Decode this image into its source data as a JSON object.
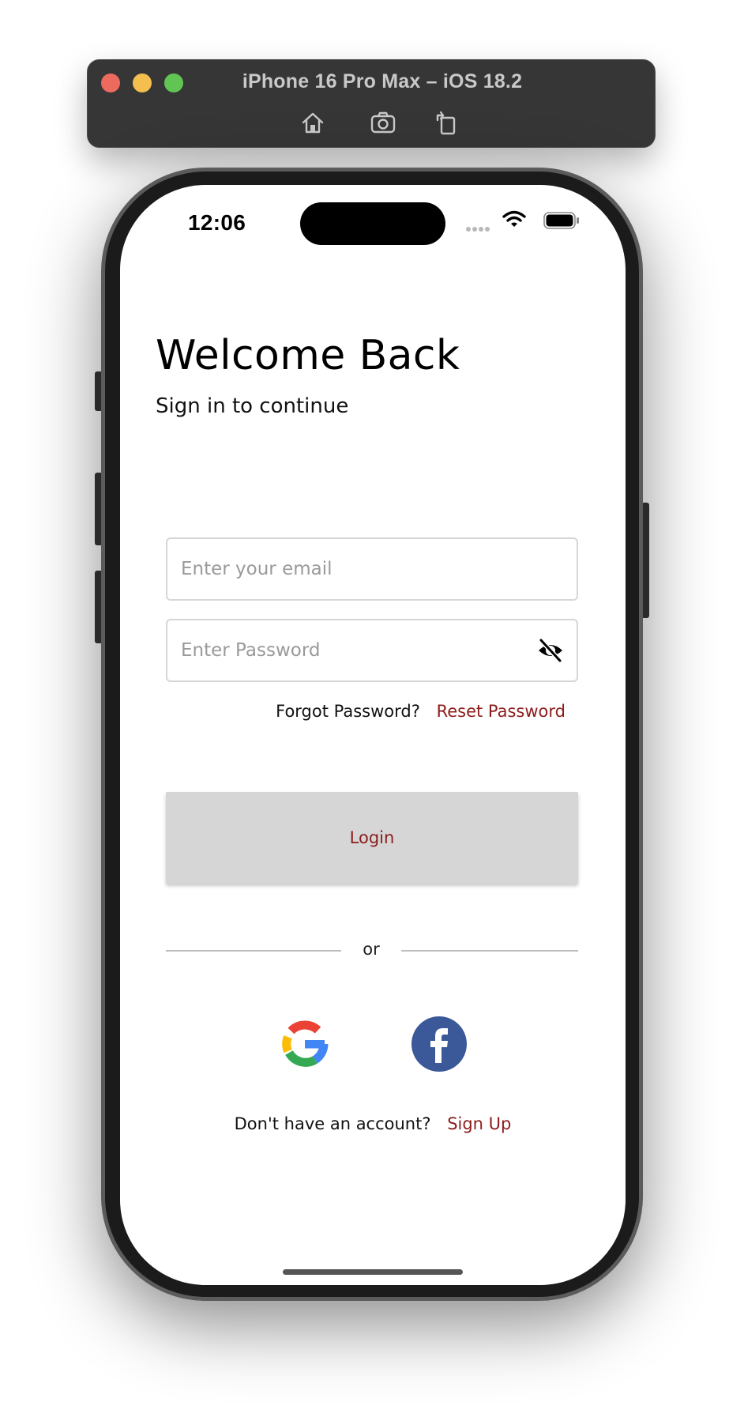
{
  "simulator": {
    "title": "iPhone 16 Pro Max – iOS 18.2",
    "toolbar": [
      "home-icon",
      "screenshot-icon",
      "rotate-icon"
    ]
  },
  "status_bar": {
    "time": "12:06"
  },
  "login": {
    "title": "Welcome Back",
    "subtitle": "Sign in to continue",
    "email_placeholder": "Enter your email",
    "email_value": "",
    "password_placeholder": "Enter Password",
    "password_value": "",
    "forgot_label": "Forgot Password?",
    "reset_link": "Reset Password",
    "login_button": "Login",
    "divider_text": "or",
    "signup_prompt": "Don't have an account?",
    "signup_link": "Sign Up"
  },
  "colors": {
    "accent": "#8c1c1c",
    "button_bg": "#d6d6d6",
    "facebook": "#3b5998"
  }
}
